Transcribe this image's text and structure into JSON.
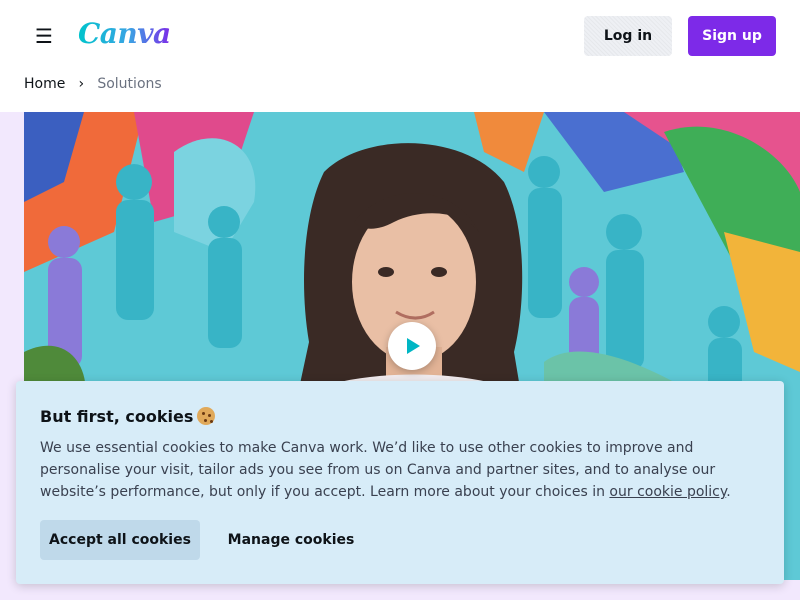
{
  "header": {
    "menu_icon": "menu-icon",
    "logo_text": "Canva",
    "login_label": "Log in",
    "signup_label": "Sign up"
  },
  "breadcrumb": {
    "home_label": "Home",
    "separator_icon": "chevron-right-icon",
    "current_label": "Solutions"
  },
  "hero": {
    "play_icon": "play-icon"
  },
  "cookie_banner": {
    "title": "But first, cookies",
    "title_icon": "cookie-icon",
    "body_text": "We use essential cookies to make Canva work. We’d like to use other cookies to improve and personalise your visit, tailor ads you see from us on Canva and partner sites, and to analyse our website’s performance, but only if you accept. Learn more about your choices in ",
    "link_text": "our cookie policy",
    "body_end": ".",
    "accept_label": "Accept all cookies",
    "manage_label": "Manage cookies"
  },
  "colors": {
    "brand_purple": "#7d2ae8",
    "brand_teal": "#00c4cc",
    "cookie_bg": "#d7ecf8",
    "hero_bg": "#f2e8fd"
  }
}
